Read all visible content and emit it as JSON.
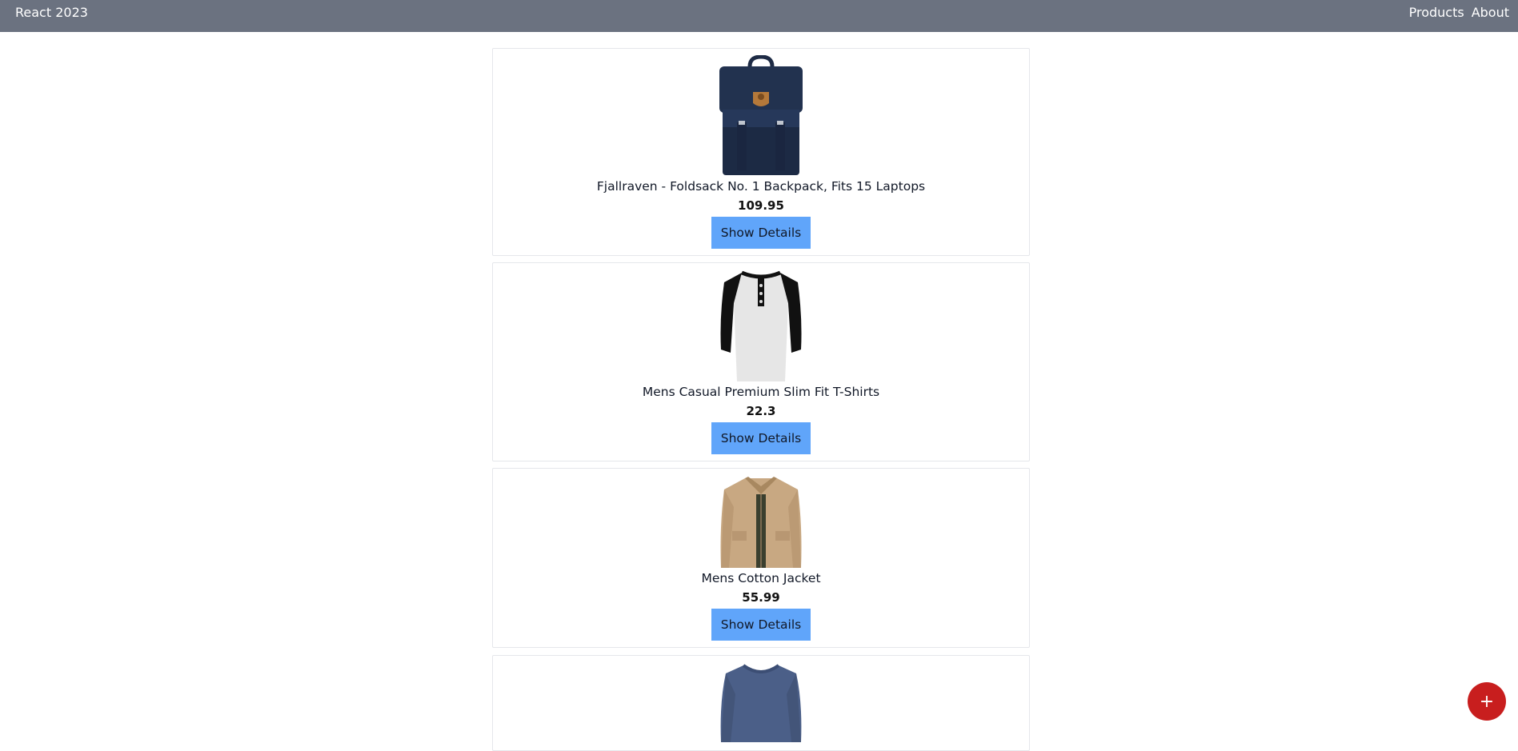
{
  "navbar": {
    "brand": "React 2023",
    "links": [
      "Products",
      "About"
    ]
  },
  "products": [
    {
      "title": "Fjallraven - Foldsack No. 1 Backpack, Fits 15 Laptops",
      "price": "109.95",
      "button": "Show Details",
      "image_icon": "backpack-image"
    },
    {
      "title": "Mens Casual Premium Slim Fit T-Shirts",
      "price": "22.3",
      "button": "Show Details",
      "image_icon": "tshirt-image"
    },
    {
      "title": "Mens Cotton Jacket",
      "price": "55.99",
      "button": "Show Details",
      "image_icon": "jacket-image"
    },
    {
      "title": "",
      "price": "",
      "button": "",
      "image_icon": "sweater-image"
    }
  ],
  "fab": {
    "label": "+"
  },
  "colors": {
    "navbar": "#6b7280",
    "button": "#60a5fa",
    "fab": "#c81e1e"
  }
}
